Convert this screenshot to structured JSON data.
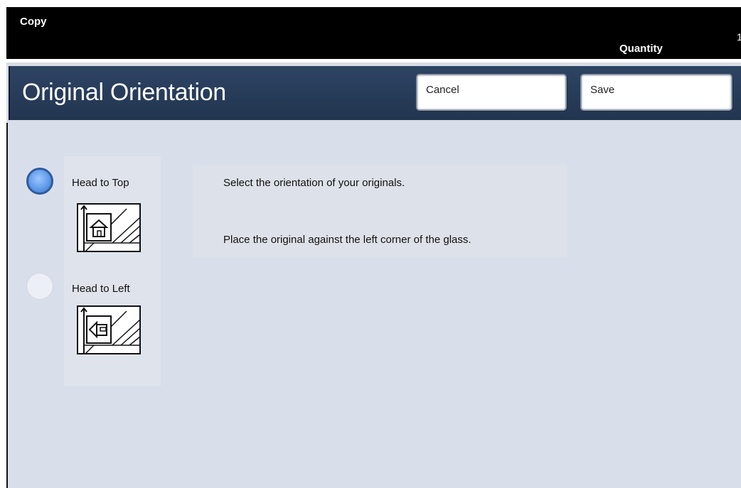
{
  "topbar": {
    "app_title": "Copy",
    "quantity_label": "Quantity",
    "stray_digit": "1"
  },
  "header": {
    "title": "Original Orientation",
    "cancel_label": "Cancel",
    "save_label": "Save"
  },
  "options": [
    {
      "label": "Head to Top",
      "selected": true
    },
    {
      "label": "Head to Left",
      "selected": false
    }
  ],
  "messages": {
    "line1": "Select the orientation of your originals.",
    "line2": "Place the original against the left corner of the glass."
  },
  "colors": {
    "header_bar": "#2d4463",
    "content_bg": "#d9dfea",
    "radio_selected": "#5b97e6"
  }
}
